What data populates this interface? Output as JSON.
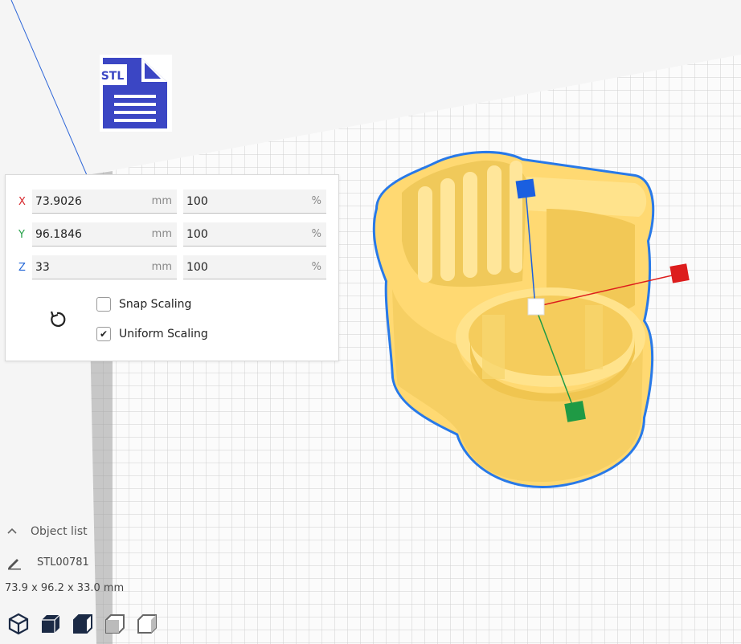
{
  "file_icon": {
    "label": "STL",
    "icon": "stl-file-icon",
    "color": "#3b46c4"
  },
  "scale_panel": {
    "rows": [
      {
        "axis": "X",
        "axis_color": "#d7262b",
        "size": "73.9026",
        "size_unit": "mm",
        "percent": "100",
        "percent_unit": "%"
      },
      {
        "axis": "Y",
        "axis_color": "#24a148",
        "size": "96.1846",
        "size_unit": "mm",
        "percent": "100",
        "percent_unit": "%"
      },
      {
        "axis": "Z",
        "axis_color": "#2266d6",
        "size": "33",
        "size_unit": "mm",
        "percent": "100",
        "percent_unit": "%"
      }
    ],
    "reset_icon": "reset-icon",
    "snap_scaling": {
      "label": "Snap Scaling",
      "checked": false
    },
    "uniform_scaling": {
      "label": "Uniform Scaling",
      "checked": true,
      "mark": "✔"
    }
  },
  "object_list": {
    "label": "Object list",
    "object_name": "STL00781",
    "dimensions": "73.9 x 96.2 x 33.0 mm"
  },
  "view_buttons": [
    "3d-view-icon",
    "front-view-icon",
    "top-view-icon",
    "left-view-icon",
    "right-view-icon"
  ],
  "colors": {
    "model": "#ffd972",
    "model_shadow": "#e2b84e",
    "selection_outline": "#2879e8",
    "gizmo_x": "#dd1d1d",
    "gizmo_y": "#1f9a45",
    "gizmo_z": "#1a5fe0"
  }
}
